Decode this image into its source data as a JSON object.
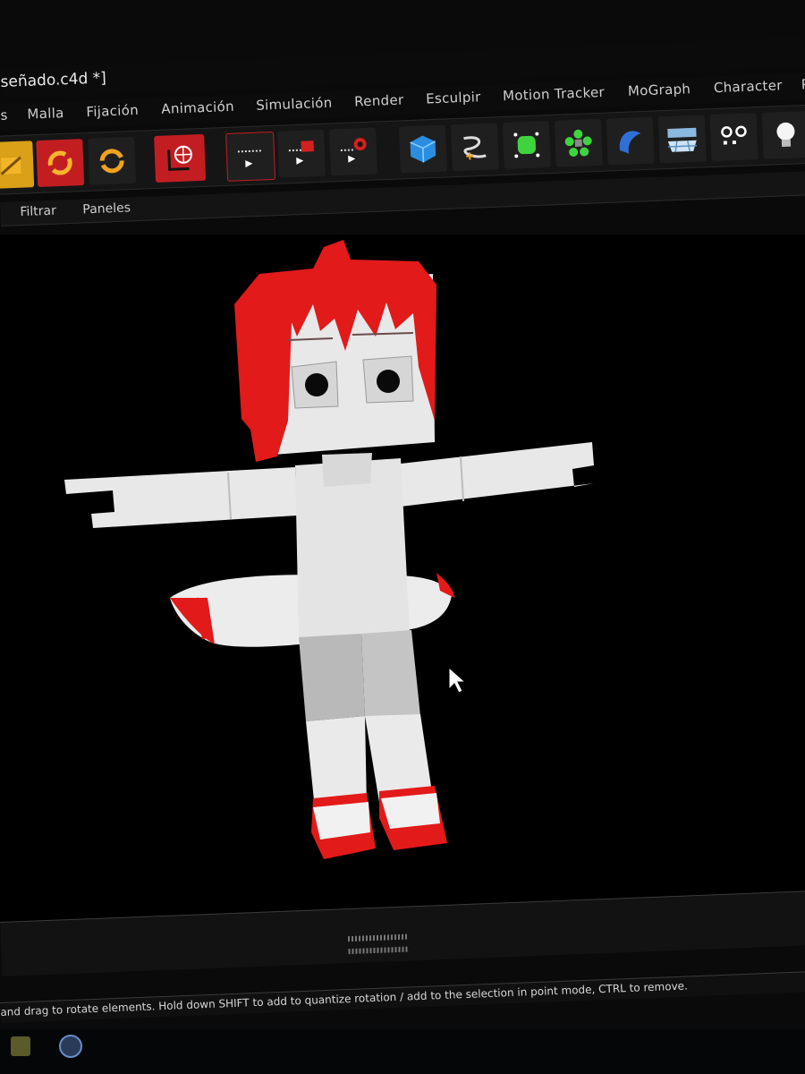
{
  "window": {
    "title": "señado.c4d *]"
  },
  "menu": {
    "items": [
      "s",
      "Malla",
      "Fijación",
      "Animación",
      "Simulación",
      "Render",
      "Esculpir",
      "Motion Tracker",
      "MoGraph",
      "Character",
      "Pl"
    ]
  },
  "toolbar": {
    "buttons": [
      {
        "icon": "move-icon"
      },
      {
        "icon": "rotate-icon",
        "active": true
      },
      {
        "icon": "scale-icon"
      },
      {
        "icon": "world-coords-icon"
      },
      {
        "icon": "render-view-icon"
      },
      {
        "icon": "render-picture-viewer-icon"
      },
      {
        "icon": "render-settings-icon"
      },
      {
        "icon": "cube-icon"
      },
      {
        "icon": "spline-pen-icon"
      },
      {
        "icon": "subdivision-icon"
      },
      {
        "icon": "cloner-icon"
      },
      {
        "icon": "deformer-icon"
      },
      {
        "icon": "floor-icon"
      },
      {
        "icon": "camera-icon"
      },
      {
        "icon": "light-icon"
      }
    ]
  },
  "submenu": {
    "items": [
      "Filtrar",
      "Paneles"
    ]
  },
  "status": {
    "text": "and drag to rotate elements. Hold down SHIFT to add to quantize rotation / add to the selection in point mode, CTRL to remove."
  },
  "colors": {
    "accent_red": "#c21e22",
    "hair_red": "#e21a1a",
    "model_white": "#e6e6e6",
    "model_gray": "#b9b9b9"
  }
}
